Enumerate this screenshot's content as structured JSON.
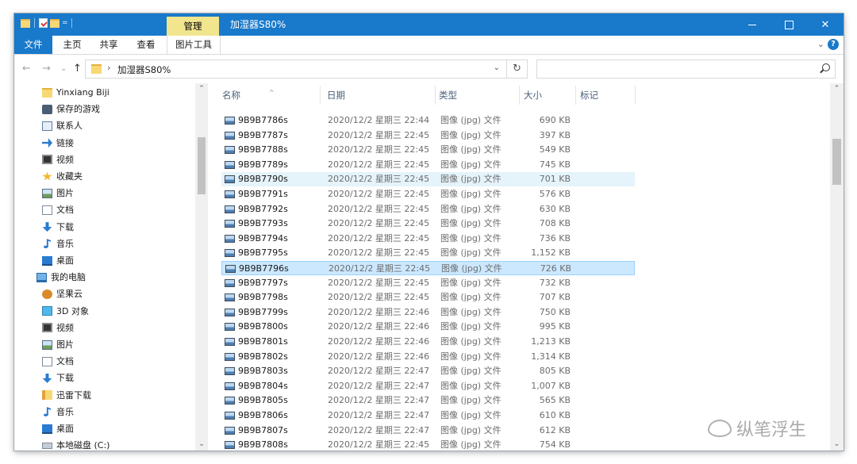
{
  "titlebar": {
    "manage_tab": "管理",
    "title": "加湿器S80%",
    "minimize": "",
    "maximize": "",
    "close": "✕"
  },
  "ribbon": {
    "tabs": [
      "文件",
      "主页",
      "共享",
      "查看",
      "图片工具"
    ]
  },
  "address": {
    "back": "←",
    "forward": "→",
    "recent": "⌄",
    "up": "↑",
    "path": "加湿器S80%",
    "refresh": "↻"
  },
  "navpane": {
    "items": [
      {
        "label": "Yinxiang Biji",
        "icon": "folder"
      },
      {
        "label": "保存的游戏",
        "icon": "game"
      },
      {
        "label": "联系人",
        "icon": "contacts"
      },
      {
        "label": "链接",
        "icon": "link"
      },
      {
        "label": "视频",
        "icon": "video"
      },
      {
        "label": "收藏夹",
        "icon": "star"
      },
      {
        "label": "图片",
        "icon": "picture"
      },
      {
        "label": "文档",
        "icon": "doc"
      },
      {
        "label": "下载",
        "icon": "download"
      },
      {
        "label": "音乐",
        "icon": "music"
      },
      {
        "label": "桌面",
        "icon": "desktop"
      },
      {
        "label": "我的电脑",
        "icon": "pc"
      },
      {
        "label": "坚果云",
        "icon": "nut"
      },
      {
        "label": "3D 对象",
        "icon": "cube"
      },
      {
        "label": "视频",
        "icon": "video"
      },
      {
        "label": "图片",
        "icon": "picture"
      },
      {
        "label": "文档",
        "icon": "doc"
      },
      {
        "label": "下载",
        "icon": "download"
      },
      {
        "label": "迅雷下载",
        "icon": "thunder"
      },
      {
        "label": "音乐",
        "icon": "music"
      },
      {
        "label": "桌面",
        "icon": "desktop"
      },
      {
        "label": "本地磁盘 (C:)",
        "icon": "drive"
      }
    ]
  },
  "columns": {
    "name": "名称",
    "date": "日期",
    "type": "类型",
    "size": "大小",
    "tags": "标记"
  },
  "files": [
    {
      "name": "9B9B7786s",
      "date": "2020/12/2 星期三 22:44",
      "type": "图像 (jpg) 文件",
      "size": "690 KB"
    },
    {
      "name": "9B9B7787s",
      "date": "2020/12/2 星期三 22:45",
      "type": "图像 (jpg) 文件",
      "size": "397 KB"
    },
    {
      "name": "9B9B7788s",
      "date": "2020/12/2 星期三 22:45",
      "type": "图像 (jpg) 文件",
      "size": "549 KB"
    },
    {
      "name": "9B9B7789s",
      "date": "2020/12/2 星期三 22:45",
      "type": "图像 (jpg) 文件",
      "size": "745 KB"
    },
    {
      "name": "9B9B7790s",
      "date": "2020/12/2 星期三 22:45",
      "type": "图像 (jpg) 文件",
      "size": "701 KB"
    },
    {
      "name": "9B9B7791s",
      "date": "2020/12/2 星期三 22:45",
      "type": "图像 (jpg) 文件",
      "size": "576 KB"
    },
    {
      "name": "9B9B7792s",
      "date": "2020/12/2 星期三 22:45",
      "type": "图像 (jpg) 文件",
      "size": "630 KB"
    },
    {
      "name": "9B9B7793s",
      "date": "2020/12/2 星期三 22:45",
      "type": "图像 (jpg) 文件",
      "size": "708 KB"
    },
    {
      "name": "9B9B7794s",
      "date": "2020/12/2 星期三 22:45",
      "type": "图像 (jpg) 文件",
      "size": "736 KB"
    },
    {
      "name": "9B9B7795s",
      "date": "2020/12/2 星期三 22:45",
      "type": "图像 (jpg) 文件",
      "size": "1,152 KB"
    },
    {
      "name": "9B9B7796s",
      "date": "2020/12/2 星期三 22:45",
      "type": "图像 (jpg) 文件",
      "size": "726 KB"
    },
    {
      "name": "9B9B7797s",
      "date": "2020/12/2 星期三 22:45",
      "type": "图像 (jpg) 文件",
      "size": "732 KB"
    },
    {
      "name": "9B9B7798s",
      "date": "2020/12/2 星期三 22:45",
      "type": "图像 (jpg) 文件",
      "size": "707 KB"
    },
    {
      "name": "9B9B7799s",
      "date": "2020/12/2 星期三 22:46",
      "type": "图像 (jpg) 文件",
      "size": "750 KB"
    },
    {
      "name": "9B9B7800s",
      "date": "2020/12/2 星期三 22:46",
      "type": "图像 (jpg) 文件",
      "size": "995 KB"
    },
    {
      "name": "9B9B7801s",
      "date": "2020/12/2 星期三 22:46",
      "type": "图像 (jpg) 文件",
      "size": "1,213 KB"
    },
    {
      "name": "9B9B7802s",
      "date": "2020/12/2 星期三 22:46",
      "type": "图像 (jpg) 文件",
      "size": "1,314 KB"
    },
    {
      "name": "9B9B7803s",
      "date": "2020/12/2 星期三 22:47",
      "type": "图像 (jpg) 文件",
      "size": "805 KB"
    },
    {
      "name": "9B9B7804s",
      "date": "2020/12/2 星期三 22:47",
      "type": "图像 (jpg) 文件",
      "size": "1,007 KB"
    },
    {
      "name": "9B9B7805s",
      "date": "2020/12/2 星期三 22:47",
      "type": "图像 (jpg) 文件",
      "size": "565 KB"
    },
    {
      "name": "9B9B7806s",
      "date": "2020/12/2 星期三 22:47",
      "type": "图像 (jpg) 文件",
      "size": "610 KB"
    },
    {
      "name": "9B9B7807s",
      "date": "2020/12/2 星期三 22:47",
      "type": "图像 (jpg) 文件",
      "size": "612 KB"
    },
    {
      "name": "9B9B7808s",
      "date": "2020/12/2 星期三 22:45",
      "type": "图像 (jpg) 文件",
      "size": "754 KB"
    }
  ],
  "hover_row": "9B9B7790s",
  "selected_row": "9B9B7796s",
  "watermark": "纵笔浮生",
  "colors": {
    "titlebar": "#1979ca",
    "manage_tab": "#f1e58e",
    "selection": "#cce8ff",
    "hover": "#e5f3fb"
  }
}
